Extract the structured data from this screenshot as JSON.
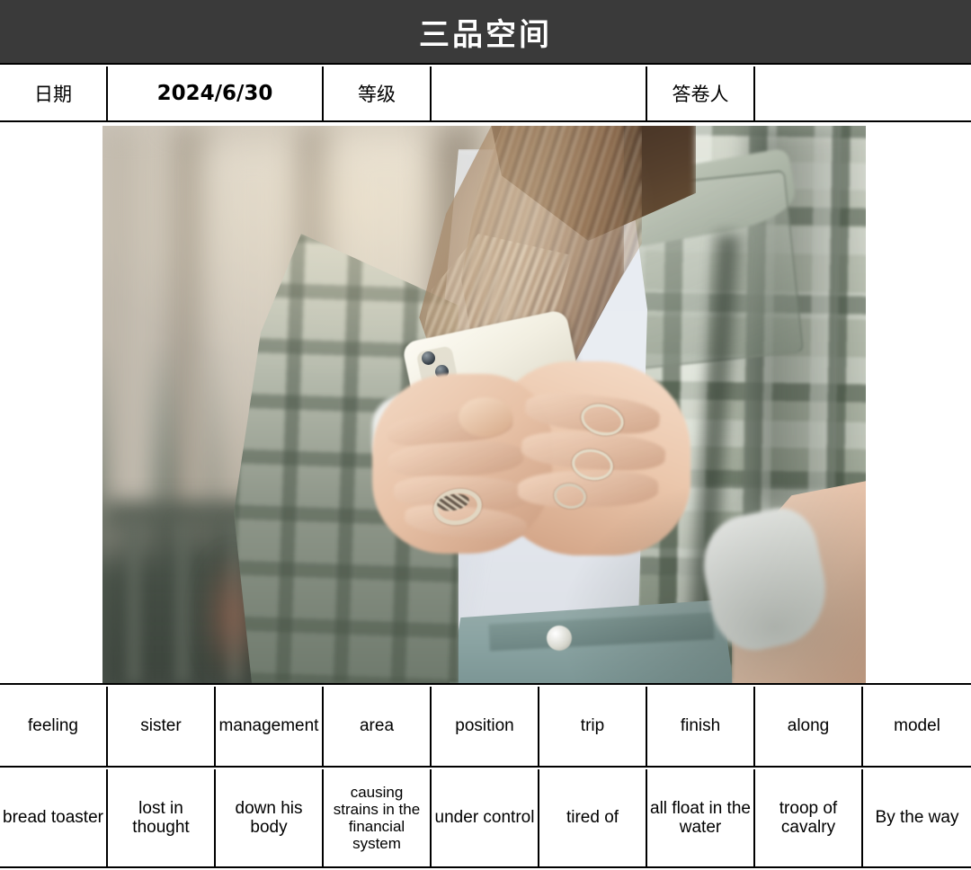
{
  "header": {
    "title": "三品空间"
  },
  "meta": {
    "date_label": "日期",
    "date_value": "2024/6/30",
    "level_label": "等级",
    "level_value": "",
    "respondent_label": "答卷人",
    "respondent_value": ""
  },
  "photo": {
    "alt": "woman in plaid flannel jacket holding a white smartphone with both hands on a blurred street"
  },
  "word_row": {
    "cells": [
      "feeling",
      "sister",
      "management",
      "area",
      "position",
      "trip",
      "finish",
      "along",
      "model"
    ]
  },
  "phrase_row": {
    "cells": [
      "bread toaster",
      "lost in thought",
      "down his body",
      "causing strains in the financial system",
      "under control",
      "tired of",
      "all float in the water",
      "troop of cavalry",
      "By the way"
    ]
  },
  "colors": {
    "title_bar": "#3a3a3a",
    "title_text": "#ffffff",
    "grid_line": "#000000",
    "cell_background": "#ffffff"
  }
}
